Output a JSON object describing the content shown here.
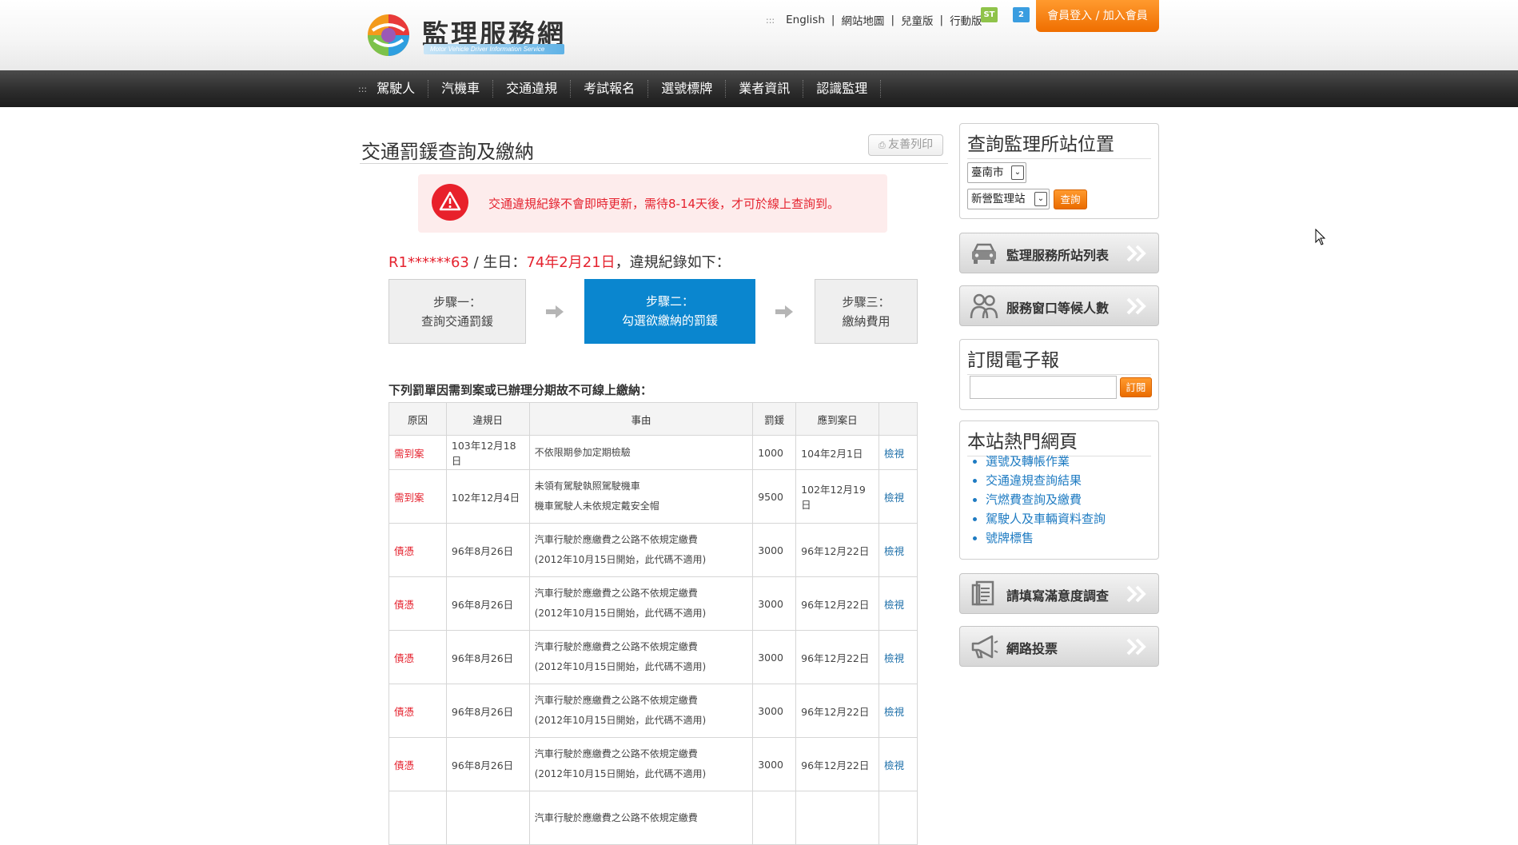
{
  "header": {
    "logo_title": "監理服務網",
    "logo_subtitle": "Motor Vehicle Driver Information Service",
    "top_links": [
      "English",
      "網站地圖",
      "兒童版",
      "行動版"
    ],
    "member_button": "會員登入 / 加入會員",
    "icon_green_text": "ST",
    "icon_blue_text": "2"
  },
  "nav": {
    "items": [
      "駕駛人",
      "汽機車",
      "交通違規",
      "考試報名",
      "選號標牌",
      "業者資訊",
      "認識監理"
    ]
  },
  "main": {
    "title": "交通罰鍰查詢及繳納",
    "print_label": "友善列印",
    "alert_text": "交通違規紀錄不會即時更新，需待8-14天後，才可於線上查詢到。",
    "plate_id": "R1******63",
    "separator": " / 生日：",
    "birthday": "74年2月21日",
    "info_suffix": "，違規紀錄如下：",
    "steps": [
      {
        "line1": "步驟一：",
        "line2": "查詢交通罰鍰"
      },
      {
        "line1": "步驟二：",
        "line2": "勾選欲繳納的罰鍰"
      },
      {
        "line1": "步驟三：",
        "line2": "繳納費用"
      }
    ],
    "table_caption": "下列罰單因需到案或已辦理分期故不可線上繳納：",
    "table": {
      "headers": [
        "原因",
        "違規日",
        "事由",
        "罰鍰",
        "應到案日",
        ""
      ],
      "rows": [
        {
          "reason": "需到案",
          "date": "103年12月18日",
          "desc1": "不依限期參加定期檢驗",
          "desc2": "",
          "fine": "1000",
          "due": "104年2月1日",
          "view": "檢視"
        },
        {
          "reason": "需到案",
          "date": "102年12月4日",
          "desc1": "未領有駕駛執照駕駛機車",
          "desc2": "機車駕駛人未依規定戴安全帽",
          "fine": "9500",
          "due": "102年12月19日",
          "view": "檢視"
        },
        {
          "reason": "債憑",
          "date": "96年8月26日",
          "desc1": "汽車行駛於應繳費之公路不依規定繳費",
          "desc2": "(2012年10月15日開始，此代碼不適用)",
          "fine": "3000",
          "due": "96年12月22日",
          "view": "檢視"
        },
        {
          "reason": "債憑",
          "date": "96年8月26日",
          "desc1": "汽車行駛於應繳費之公路不依規定繳費",
          "desc2": "(2012年10月15日開始，此代碼不適用)",
          "fine": "3000",
          "due": "96年12月22日",
          "view": "檢視"
        },
        {
          "reason": "債憑",
          "date": "96年8月26日",
          "desc1": "汽車行駛於應繳費之公路不依規定繳費",
          "desc2": "(2012年10月15日開始，此代碼不適用)",
          "fine": "3000",
          "due": "96年12月22日",
          "view": "檢視"
        },
        {
          "reason": "債憑",
          "date": "96年8月26日",
          "desc1": "汽車行駛於應繳費之公路不依規定繳費",
          "desc2": "(2012年10月15日開始，此代碼不適用)",
          "fine": "3000",
          "due": "96年12月22日",
          "view": "檢視"
        },
        {
          "reason": "債憑",
          "date": "96年8月26日",
          "desc1": "汽車行駛於應繳費之公路不依規定繳費",
          "desc2": "(2012年10月15日開始，此代碼不適用)",
          "fine": "3000",
          "due": "96年12月22日",
          "view": "檢視"
        },
        {
          "reason": "",
          "date": "",
          "desc1": "汽車行駛於應繳費之公路不依規定繳費",
          "desc2": "",
          "fine": "",
          "due": "",
          "view": ""
        }
      ]
    }
  },
  "sidebar": {
    "location_title": "查詢監理所站位置",
    "city_select": "臺南市",
    "office_select": "新營監理站",
    "query_button": "查詢",
    "station_list_label": "監理服務所站列表",
    "waiting_label": "服務窗口等候人數",
    "newsletter_title": "訂閱電子報",
    "newsletter_placeholder": "",
    "subscribe_button": "訂閱",
    "hot_title": "本站熱門網頁",
    "hot_links": [
      "選號及轉帳作業",
      "交通違規查詢結果",
      "汽燃費查詢及繳費",
      "駕駛人及車輛資料查詢",
      "號牌標售"
    ],
    "survey_label": "請填寫滿意度調查",
    "vote_label": "網路投票"
  },
  "colors": {
    "accent_orange": "#f07800",
    "alert_red": "#e5232f",
    "step_active_blue": "#0a86cf",
    "link_blue": "#1e7bc2"
  }
}
